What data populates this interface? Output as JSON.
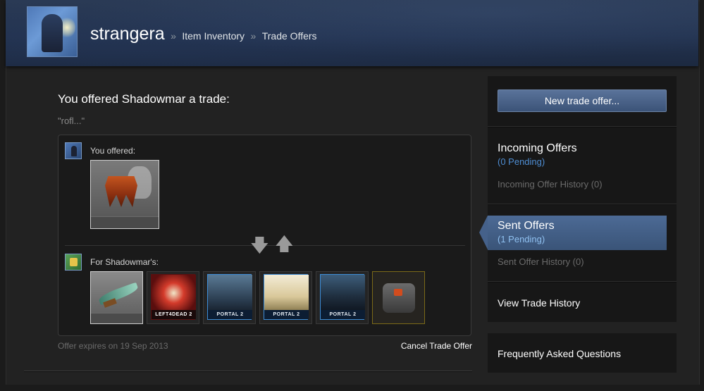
{
  "header": {
    "username": "strangera",
    "breadcrumb_sep": "»",
    "crumbs": [
      "Item Inventory",
      "Trade Offers"
    ]
  },
  "offer": {
    "title": "You offered Shadowmar a trade:",
    "message": "\"rofl...\"",
    "you_offered_label": "You offered:",
    "for_label": "For Shadowmar's:",
    "expires": "Offer expires on 19 Sep 2013",
    "cancel": "Cancel Trade Offer",
    "their_items": [
      {
        "kind": "weapon"
      },
      {
        "kind": "card",
        "logo": "LEFT4DEAD 2"
      },
      {
        "kind": "card",
        "logo": "PORTAL 2"
      },
      {
        "kind": "card",
        "logo": "PORTAL 2"
      },
      {
        "kind": "card",
        "logo": "PORTAL 2"
      },
      {
        "kind": "crate"
      }
    ]
  },
  "sidebar": {
    "new_offer_button": "New trade offer...",
    "incoming": {
      "title": "Incoming Offers",
      "pending": "(0 Pending)",
      "history": "Incoming Offer History (0)"
    },
    "sent": {
      "title": "Sent Offers",
      "pending": "(1 Pending)",
      "history": "Sent Offer History (0)"
    },
    "view_history": "View Trade History",
    "faq": "Frequently Asked Questions"
  },
  "colors": {
    "accent": "#4e8dd2",
    "active_tab": "#45618a",
    "unusual_border": "#7b6a18"
  }
}
